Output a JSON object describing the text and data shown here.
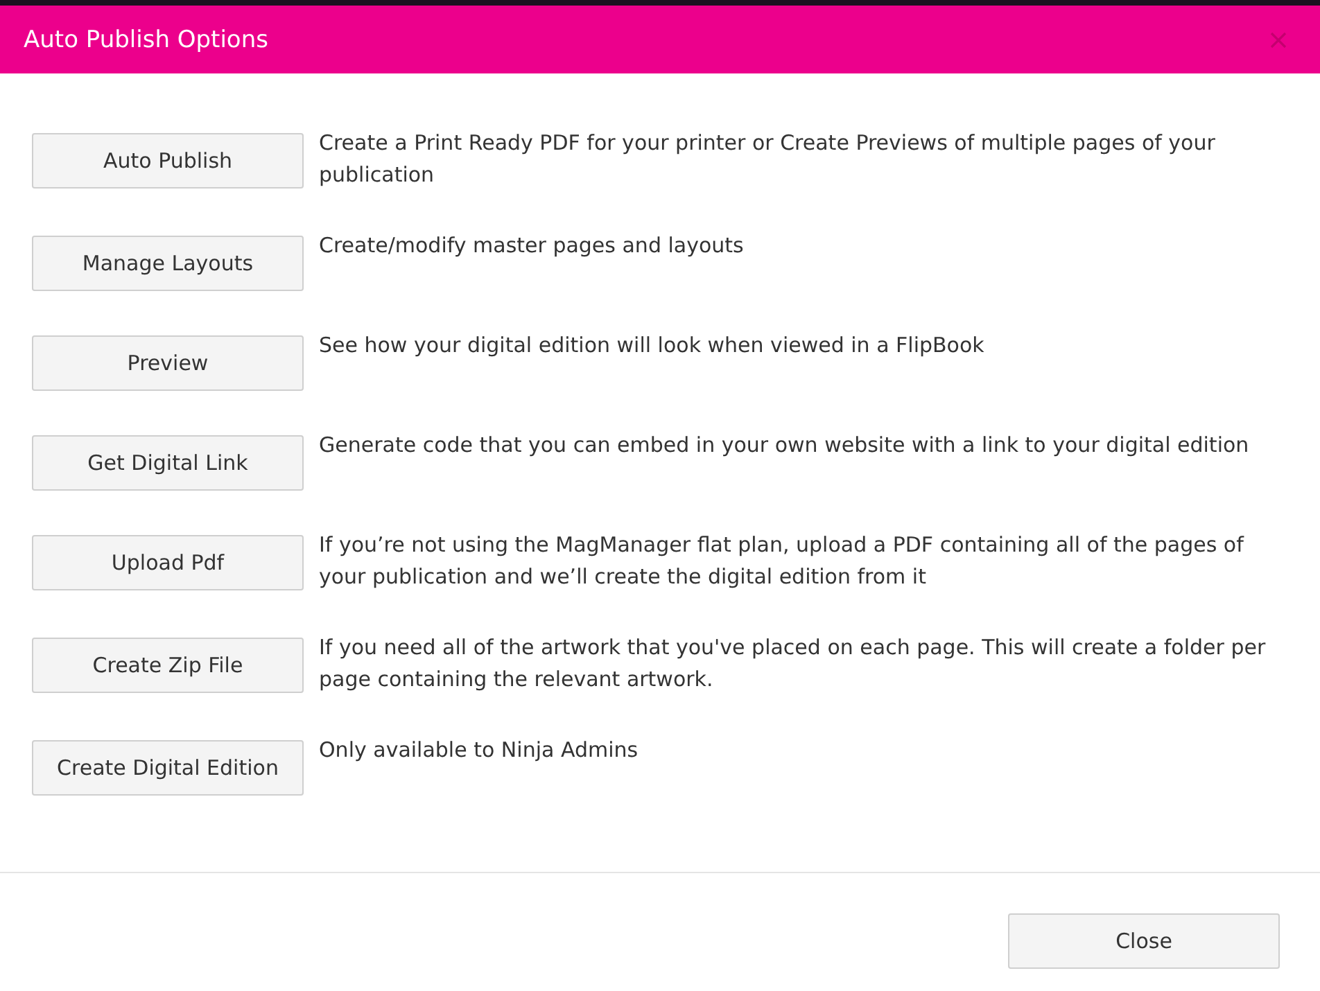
{
  "dialog": {
    "title": "Auto Publish Options"
  },
  "options": [
    {
      "button": "Auto Publish",
      "description": "Create a Print Ready PDF for your printer or Create Previews of multiple pages of your publication"
    },
    {
      "button": "Manage Layouts",
      "description": "Create/modify master pages and layouts"
    },
    {
      "button": "Preview",
      "description": "See how your digital edition will look when viewed in a FlipBook"
    },
    {
      "button": "Get Digital Link",
      "description": "Generate code that you can embed in your own website with a link to your digital edition"
    },
    {
      "button": "Upload Pdf",
      "description": "If you’re not using the MagManager flat plan, upload a PDF containing all of the pages of your publication and we’ll create the digital edition from it"
    },
    {
      "button": "Create Zip File",
      "description": "If you need all of the artwork that you've placed on each page. This will create a folder per page containing the relevant artwork."
    },
    {
      "button": "Create Digital Edition",
      "description": "Only available to Ninja Admins"
    }
  ],
  "footer": {
    "close_button": "Close"
  }
}
